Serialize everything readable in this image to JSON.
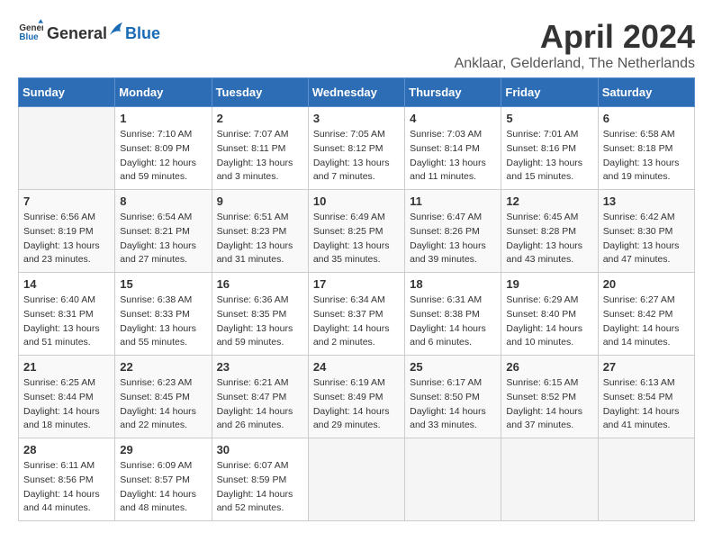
{
  "header": {
    "logo": {
      "general": "General",
      "blue": "Blue"
    },
    "title": "April 2024",
    "subtitle": "Anklaar, Gelderland, The Netherlands"
  },
  "calendar": {
    "days_of_week": [
      "Sunday",
      "Monday",
      "Tuesday",
      "Wednesday",
      "Thursday",
      "Friday",
      "Saturday"
    ],
    "weeks": [
      [
        {
          "day": "",
          "sunrise": "",
          "sunset": "",
          "daylight": ""
        },
        {
          "day": "1",
          "sunrise": "Sunrise: 7:10 AM",
          "sunset": "Sunset: 8:09 PM",
          "daylight": "Daylight: 12 hours and 59 minutes."
        },
        {
          "day": "2",
          "sunrise": "Sunrise: 7:07 AM",
          "sunset": "Sunset: 8:11 PM",
          "daylight": "Daylight: 13 hours and 3 minutes."
        },
        {
          "day": "3",
          "sunrise": "Sunrise: 7:05 AM",
          "sunset": "Sunset: 8:12 PM",
          "daylight": "Daylight: 13 hours and 7 minutes."
        },
        {
          "day": "4",
          "sunrise": "Sunrise: 7:03 AM",
          "sunset": "Sunset: 8:14 PM",
          "daylight": "Daylight: 13 hours and 11 minutes."
        },
        {
          "day": "5",
          "sunrise": "Sunrise: 7:01 AM",
          "sunset": "Sunset: 8:16 PM",
          "daylight": "Daylight: 13 hours and 15 minutes."
        },
        {
          "day": "6",
          "sunrise": "Sunrise: 6:58 AM",
          "sunset": "Sunset: 8:18 PM",
          "daylight": "Daylight: 13 hours and 19 minutes."
        }
      ],
      [
        {
          "day": "7",
          "sunrise": "Sunrise: 6:56 AM",
          "sunset": "Sunset: 8:19 PM",
          "daylight": "Daylight: 13 hours and 23 minutes."
        },
        {
          "day": "8",
          "sunrise": "Sunrise: 6:54 AM",
          "sunset": "Sunset: 8:21 PM",
          "daylight": "Daylight: 13 hours and 27 minutes."
        },
        {
          "day": "9",
          "sunrise": "Sunrise: 6:51 AM",
          "sunset": "Sunset: 8:23 PM",
          "daylight": "Daylight: 13 hours and 31 minutes."
        },
        {
          "day": "10",
          "sunrise": "Sunrise: 6:49 AM",
          "sunset": "Sunset: 8:25 PM",
          "daylight": "Daylight: 13 hours and 35 minutes."
        },
        {
          "day": "11",
          "sunrise": "Sunrise: 6:47 AM",
          "sunset": "Sunset: 8:26 PM",
          "daylight": "Daylight: 13 hours and 39 minutes."
        },
        {
          "day": "12",
          "sunrise": "Sunrise: 6:45 AM",
          "sunset": "Sunset: 8:28 PM",
          "daylight": "Daylight: 13 hours and 43 minutes."
        },
        {
          "day": "13",
          "sunrise": "Sunrise: 6:42 AM",
          "sunset": "Sunset: 8:30 PM",
          "daylight": "Daylight: 13 hours and 47 minutes."
        }
      ],
      [
        {
          "day": "14",
          "sunrise": "Sunrise: 6:40 AM",
          "sunset": "Sunset: 8:31 PM",
          "daylight": "Daylight: 13 hours and 51 minutes."
        },
        {
          "day": "15",
          "sunrise": "Sunrise: 6:38 AM",
          "sunset": "Sunset: 8:33 PM",
          "daylight": "Daylight: 13 hours and 55 minutes."
        },
        {
          "day": "16",
          "sunrise": "Sunrise: 6:36 AM",
          "sunset": "Sunset: 8:35 PM",
          "daylight": "Daylight: 13 hours and 59 minutes."
        },
        {
          "day": "17",
          "sunrise": "Sunrise: 6:34 AM",
          "sunset": "Sunset: 8:37 PM",
          "daylight": "Daylight: 14 hours and 2 minutes."
        },
        {
          "day": "18",
          "sunrise": "Sunrise: 6:31 AM",
          "sunset": "Sunset: 8:38 PM",
          "daylight": "Daylight: 14 hours and 6 minutes."
        },
        {
          "day": "19",
          "sunrise": "Sunrise: 6:29 AM",
          "sunset": "Sunset: 8:40 PM",
          "daylight": "Daylight: 14 hours and 10 minutes."
        },
        {
          "day": "20",
          "sunrise": "Sunrise: 6:27 AM",
          "sunset": "Sunset: 8:42 PM",
          "daylight": "Daylight: 14 hours and 14 minutes."
        }
      ],
      [
        {
          "day": "21",
          "sunrise": "Sunrise: 6:25 AM",
          "sunset": "Sunset: 8:44 PM",
          "daylight": "Daylight: 14 hours and 18 minutes."
        },
        {
          "day": "22",
          "sunrise": "Sunrise: 6:23 AM",
          "sunset": "Sunset: 8:45 PM",
          "daylight": "Daylight: 14 hours and 22 minutes."
        },
        {
          "day": "23",
          "sunrise": "Sunrise: 6:21 AM",
          "sunset": "Sunset: 8:47 PM",
          "daylight": "Daylight: 14 hours and 26 minutes."
        },
        {
          "day": "24",
          "sunrise": "Sunrise: 6:19 AM",
          "sunset": "Sunset: 8:49 PM",
          "daylight": "Daylight: 14 hours and 29 minutes."
        },
        {
          "day": "25",
          "sunrise": "Sunrise: 6:17 AM",
          "sunset": "Sunset: 8:50 PM",
          "daylight": "Daylight: 14 hours and 33 minutes."
        },
        {
          "day": "26",
          "sunrise": "Sunrise: 6:15 AM",
          "sunset": "Sunset: 8:52 PM",
          "daylight": "Daylight: 14 hours and 37 minutes."
        },
        {
          "day": "27",
          "sunrise": "Sunrise: 6:13 AM",
          "sunset": "Sunset: 8:54 PM",
          "daylight": "Daylight: 14 hours and 41 minutes."
        }
      ],
      [
        {
          "day": "28",
          "sunrise": "Sunrise: 6:11 AM",
          "sunset": "Sunset: 8:56 PM",
          "daylight": "Daylight: 14 hours and 44 minutes."
        },
        {
          "day": "29",
          "sunrise": "Sunrise: 6:09 AM",
          "sunset": "Sunset: 8:57 PM",
          "daylight": "Daylight: 14 hours and 48 minutes."
        },
        {
          "day": "30",
          "sunrise": "Sunrise: 6:07 AM",
          "sunset": "Sunset: 8:59 PM",
          "daylight": "Daylight: 14 hours and 52 minutes."
        },
        {
          "day": "",
          "sunrise": "",
          "sunset": "",
          "daylight": ""
        },
        {
          "day": "",
          "sunrise": "",
          "sunset": "",
          "daylight": ""
        },
        {
          "day": "",
          "sunrise": "",
          "sunset": "",
          "daylight": ""
        },
        {
          "day": "",
          "sunrise": "",
          "sunset": "",
          "daylight": ""
        }
      ]
    ]
  }
}
